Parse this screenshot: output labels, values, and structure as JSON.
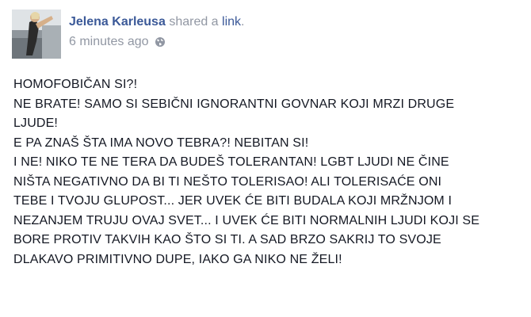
{
  "post": {
    "author": "Jelena Karleusa",
    "action_prefix": "shared a",
    "action_link": "link",
    "action_suffix": ".",
    "timestamp": "6 minutes ago",
    "privacy_icon": "globe-icon",
    "lines": [
      "HOMOFOBIČAN SI?!",
      "NE BRATE! SAMO SI SEBIČNI IGNORANTNI GOVNAR KOJI MRZI DRUGE",
      "LJUDE!",
      "E PA ZNAŠ ŠTA IMA NOVO TEBRA?! NEBITAN SI!",
      "I NE! NIKO TE NE TERA DA BUDEŠ TOLERANTAN! LGBT LJUDI NE ČINE",
      "NIŠTA NEGATIVNO DA BI TI NEŠTO TOLERISAO! ALI TOLERISAĆE ONI",
      "TEBE I TVOJU GLUPOST... JER UVEK ĆE BITI BUDALA KOJI MRŽNJOM I",
      "NEZANJEM TRUJU OVAJ SVET... I UVEK ĆE BITI NORMALNIH LJUDI KOJI SE",
      "BORE PROTIV TAKVIH KAO ŠTO SI TI. A SAD BRZO SAKRIJ TO SVOJE",
      "DLAKAVO PRIMITIVNO DUPE, IAKO GA NIKO NE ŽELI!"
    ]
  },
  "colors": {
    "link": "#3b5998",
    "meta": "#9197a3",
    "text": "#141823"
  }
}
